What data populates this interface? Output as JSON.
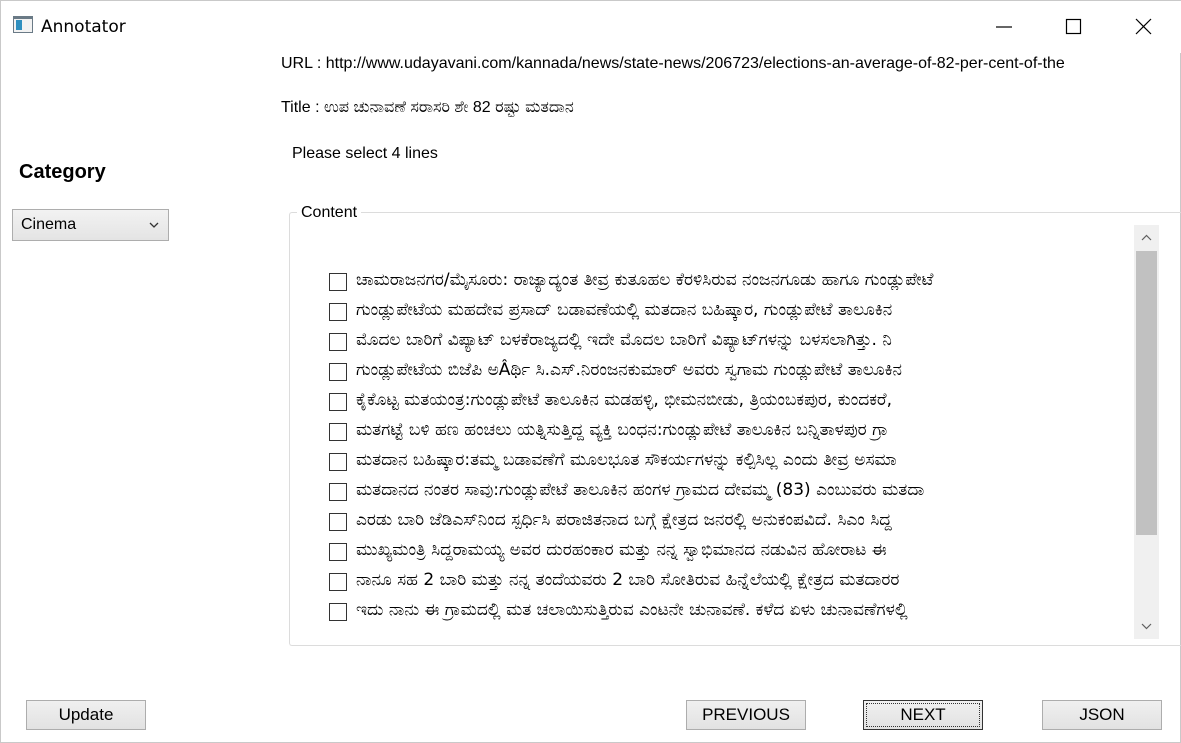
{
  "window": {
    "title": "Annotator"
  },
  "header": {
    "url_text": "URL : http://www.udayavani.com/kannada/news/state-news/206723/elections-an-average-of-82-per-cent-of-the",
    "title_text": "Title : ಉಪ ಚುನಾವಣೆ ಸರಾಸರಿ ಶೇ 82 ರಷ್ಟು ಮತದಾನ",
    "prompt_text": "Please select 4 lines"
  },
  "sidebar": {
    "category_label": "Category",
    "category_selected": "Cinema"
  },
  "content": {
    "legend": "Content",
    "lines": [
      {
        "text": "ಚಾಮರಾಜನಗರ/ಮೈಸೂರು: ರಾಜ್ಯಾದ್ಯಂತ ತೀವ್ರ ಕುತೂಹಲ ಕೆರಳಿಸಿರುವ ನಂಜನಗೂಡು ಹಾಗೂ ಗುಂಡ್ಲುಪೇಟೆ",
        "checked": false
      },
      {
        "text": "ಗುಂಡ್ಲುಪೇಟೆಯ ಮಹದೇವ ಪ್ರಸಾದ್ ಬಡಾವಣೆಯಲ್ಲಿ ಮತದಾನ ಬಹಿಷ್ಕಾರ, ಗುಂಡ್ಲುಪೇಟೆ ತಾಲೂಕಿನ",
        "checked": false
      },
      {
        "text": "ಮೊದಲ ಬಾರಿಗೆ ವಿಪ್ಯಾಟ್ ಬಳಕೆರಾಜ್ಯದಲ್ಲಿ ಇದೇ ಮೊದಲ ಬಾರಿಗೆ ವಿಪ್ಯಾಟ್‌ಗಳನ್ನು ಬಳಸಲಾಗಿತ್ತು. ನಿ",
        "checked": false
      },
      {
        "text": "ಗುಂಡ್ಲುಪೇಟೆಯ ಬಿಜೆಪಿ ಅÂರ್ಥಿ ಸಿ.ಎಸ್.ನಿರಂಜನಕುಮಾರ್ ಅವರು ಸ್ವಗಾಮ ಗುಂಡ್ಲುಪೇಟೆ ತಾಲೂಕಿನ",
        "checked": false
      },
      {
        "text": "ಕೈಕೊಟ್ಟ ಮತಯಂತ್ರ:ಗುಂಡ್ಲುಪೇಟೆ ತಾಲೂಕಿನ ಮಡಹಳ್ಳಿ, ಭೀಮನಬೀಡು, ತ್ರಿಯಂಬಕಪುರ, ಕುಂದಕರೆ,",
        "checked": false
      },
      {
        "text": "ಮತಗಟ್ಟೆ ಬಳಿ ಹಣ ಹಂಚಲು ಯತ್ನಿಸುತ್ತಿದ್ದ ವ್ಯಕ್ತಿ ಬಂಧನ:ಗುಂಡ್ಲುಪೇಟೆ ತಾಲೂಕಿನ ಬನ್ನಿತಾಳಪುರ ಗ್ರಾ",
        "checked": false
      },
      {
        "text": "ಮತದಾನ ಬಹಿಷ್ಕಾರ:ತಮ್ಮ ಬಡಾವಣೆಗೆ ಮೂಲಭೂತ ಸೌಕರ್ಯಗಳನ್ನು ಕಲ್ಪಿಸಿಲ್ಲ ಎಂದು ತೀವ್ರ ಅಸಮಾ",
        "checked": false
      },
      {
        "text": "ಮತದಾನದ ನಂತರ ಸಾವು:ಗುಂಡ್ಲುಪೇಟೆ ತಾಲೂಕಿನ ಹಂಗಳ ಗ್ರಾಮದ ದೇವಮ್ಮ (83) ಎಂಬುವರು ಮತದಾ",
        "checked": false
      },
      {
        "text": "ಎರಡು ಬಾರಿ ಜೆಡಿಎಸ್‌ನಿಂದ ಸ್ಪರ್ಧಿಸಿ ಪರಾಜಿತನಾದ ಬಗ್ಗೆ ಕ್ಷೇತ್ರದ ಜನರಲ್ಲಿ ಅನುಕಂಪವಿದೆ. ಸಿಎಂ ಸಿದ್ದ",
        "checked": false
      },
      {
        "text": "ಮುಖ್ಯಮಂತ್ರಿ ಸಿದ್ದರಾಮಯ್ಯ ಅವರ ದುರಹಂಕಾರ ಮತ್ತು ನನ್ನ ಸ್ವಾಭಿಮಾನದ ನಡುವಿನ ಹೋರಾಟ ಈ",
        "checked": false
      },
      {
        "text": "ನಾನೂ ಸಹ 2 ಬಾರಿ ಮತ್ತು ನನ್ನ ತಂದೆಯವರು 2 ಬಾರಿ ಸೋತಿರುವ ಹಿನ್ನೆಲೆಯಲ್ಲಿ ಕ್ಷೇತ್ರದ ಮತದಾರರ",
        "checked": false
      },
      {
        "text": "ಇದು ನಾನು ಈ ಗ್ರಾಮದಲ್ಲಿ ಮತ ಚಲಾಯಿಸುತ್ತಿರುವ ಎಂಟನೇ ಚುನಾವಣೆ. ಕಳೆದ ಏಳು ಚುನಾವಣೆಗಳಲ್ಲಿ",
        "checked": false
      }
    ]
  },
  "buttons": {
    "update": "Update",
    "previous": "PREVIOUS",
    "next": "NEXT",
    "json": "JSON"
  },
  "icons": {
    "app": "app-window-icon",
    "minimize": "minimize-icon",
    "maximize": "maximize-icon",
    "close": "close-icon",
    "dropdown": "chevron-down-icon",
    "scroll_up": "chevron-up-icon",
    "scroll_down": "chevron-down-icon"
  }
}
